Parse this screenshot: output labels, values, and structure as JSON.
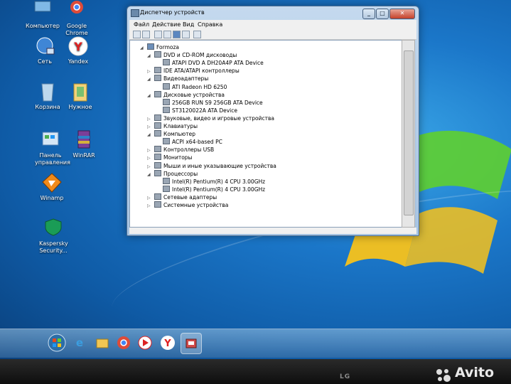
{
  "desktop": {
    "icons": [
      {
        "label": "Компьютер",
        "icon": "computer-icon"
      },
      {
        "label": "Google Chrome",
        "icon": "chrome-icon"
      },
      {
        "label": "Сеть",
        "icon": "network-icon"
      },
      {
        "label": "Yandex",
        "icon": "yandex-icon"
      },
      {
        "label": "Корзина",
        "icon": "recycle-bin-icon"
      },
      {
        "label": "Нужное",
        "icon": "folder-icon"
      },
      {
        "label": "Панель управления",
        "icon": "control-panel-icon"
      },
      {
        "label": "WinRAR",
        "icon": "winrar-icon"
      },
      {
        "label": "Winamp",
        "icon": "winamp-icon"
      },
      {
        "label": "Kaspersky Security...",
        "icon": "kaspersky-icon"
      }
    ]
  },
  "window": {
    "title": "Диспетчер устройств",
    "menu": [
      "Файл",
      "Действие",
      "Вид",
      "Справка"
    ],
    "tree": [
      {
        "label": "Formoza",
        "exp": "◢",
        "level": 0,
        "root": true
      },
      {
        "label": "DVD и CD-ROM дисководы",
        "exp": "◢",
        "level": 1
      },
      {
        "label": "ATAPI DVD A  DH20A4P ATA Device",
        "exp": "",
        "level": 2
      },
      {
        "label": "IDE ATA/ATAPI контроллеры",
        "exp": "▷",
        "level": 1
      },
      {
        "label": "Видеоадаптеры",
        "exp": "◢",
        "level": 1
      },
      {
        "label": "ATI Radeon HD 6250",
        "exp": "",
        "level": 2
      },
      {
        "label": "Дисковые устройства",
        "exp": "◢",
        "level": 1
      },
      {
        "label": "256GB RUN S9 256GB ATA Device",
        "exp": "",
        "level": 2
      },
      {
        "label": "ST3120022A ATA Device",
        "exp": "",
        "level": 2
      },
      {
        "label": "Звуковые, видео и игровые устройства",
        "exp": "▷",
        "level": 1
      },
      {
        "label": "Клавиатуры",
        "exp": "▷",
        "level": 1
      },
      {
        "label": "Компьютер",
        "exp": "◢",
        "level": 1
      },
      {
        "label": "ACPI x64-based PC",
        "exp": "",
        "level": 2
      },
      {
        "label": "Контроллеры USB",
        "exp": "▷",
        "level": 1
      },
      {
        "label": "Мониторы",
        "exp": "▷",
        "level": 1
      },
      {
        "label": "Мыши и иные указывающие устройства",
        "exp": "▷",
        "level": 1
      },
      {
        "label": "Процессоры",
        "exp": "◢",
        "level": 1
      },
      {
        "label": "Intel(R) Pentium(R) 4 CPU 3.00GHz",
        "exp": "",
        "level": 2
      },
      {
        "label": "Intel(R) Pentium(R) 4 CPU 3.00GHz",
        "exp": "",
        "level": 2
      },
      {
        "label": "Сетевые адаптеры",
        "exp": "▷",
        "level": 1
      },
      {
        "label": "Системные устройства",
        "exp": "▷",
        "level": 1
      }
    ]
  },
  "taskbar": {
    "items": [
      "start-orb-icon",
      "ie-icon",
      "explorer-folder-icon",
      "chrome-icon",
      "media-player-icon",
      "yandex-icon",
      "device-manager-icon"
    ]
  },
  "monitor": {
    "brand": "LG",
    "watermark": "Avito"
  },
  "colors": {
    "desktop_blue": "#1b77c9",
    "window_frame": "#b8d0ea",
    "close_red": "#c5412a"
  }
}
